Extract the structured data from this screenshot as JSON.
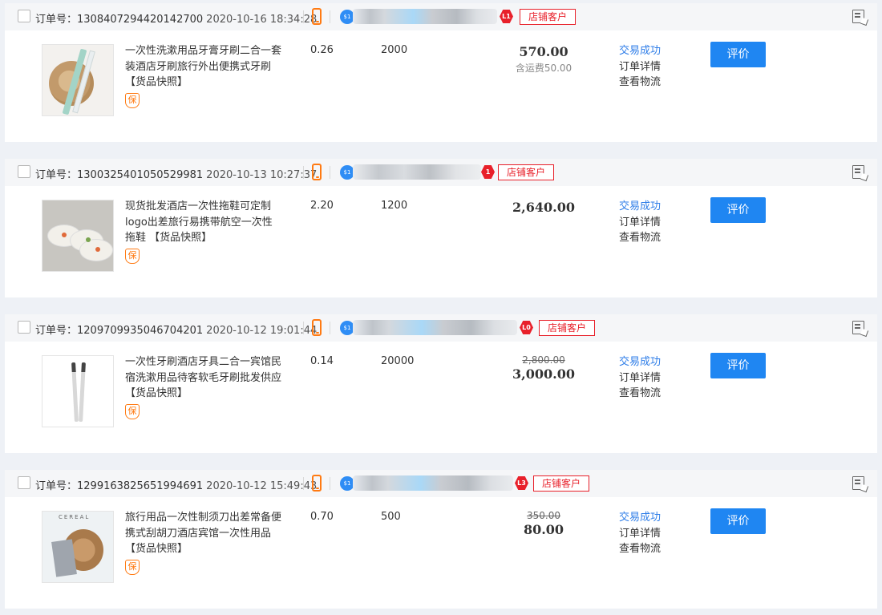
{
  "labels": {
    "order_no_prefix": "订单号：",
    "snapshot": "【货品快照】",
    "store_customer": "店铺客户",
    "status_success": "交易成功",
    "order_detail": "订单详情",
    "view_logistics": "查看物流",
    "review_button": "评价",
    "guarantee_glyph": "保"
  },
  "orders": [
    {
      "order_no": "1308407294420142700",
      "date": "2020-10-16 18:34:28",
      "level_badge": "L1",
      "title": "一次性洗漱用品牙膏牙刷二合一套装酒店牙刷旅行外出便携式牙刷",
      "unit_price": "0.26",
      "quantity": "2000",
      "original_total": "",
      "total": "570.00",
      "shipping": "含运费50.00"
    },
    {
      "order_no": "1300325401050529981",
      "date": "2020-10-13 10:27:37",
      "level_badge": "1",
      "title": "现货批发酒店一次性拖鞋可定制logo出差旅行易携带航空一次性拖鞋",
      "unit_price": "2.20",
      "quantity": "1200",
      "original_total": "",
      "total": "2,640.00",
      "shipping": ""
    },
    {
      "order_no": "1209709935046704201",
      "date": "2020-10-12 19:01:44",
      "level_badge": "L0",
      "title": "一次性牙刷酒店牙具二合一宾馆民宿洗漱用品待客软毛牙刷批发供应",
      "unit_price": "0.14",
      "quantity": "20000",
      "original_total": "2,800.00",
      "total": "3,000.00",
      "shipping": ""
    },
    {
      "order_no": "1299163825651994691",
      "date": "2020-10-12 15:49:43",
      "level_badge": "L3",
      "title": "旅行用品一次性制须刀出差常备便携式刮胡刀酒店宾馆一次性用品",
      "unit_price": "0.70",
      "quantity": "500",
      "original_total": "350.00",
      "total": "80.00",
      "shipping": ""
    }
  ],
  "colors": {
    "accent": "#1f86f2",
    "success": "#2f7ee8",
    "tag_red": "#e8202a",
    "mobile_orange": "#ff7a12"
  }
}
